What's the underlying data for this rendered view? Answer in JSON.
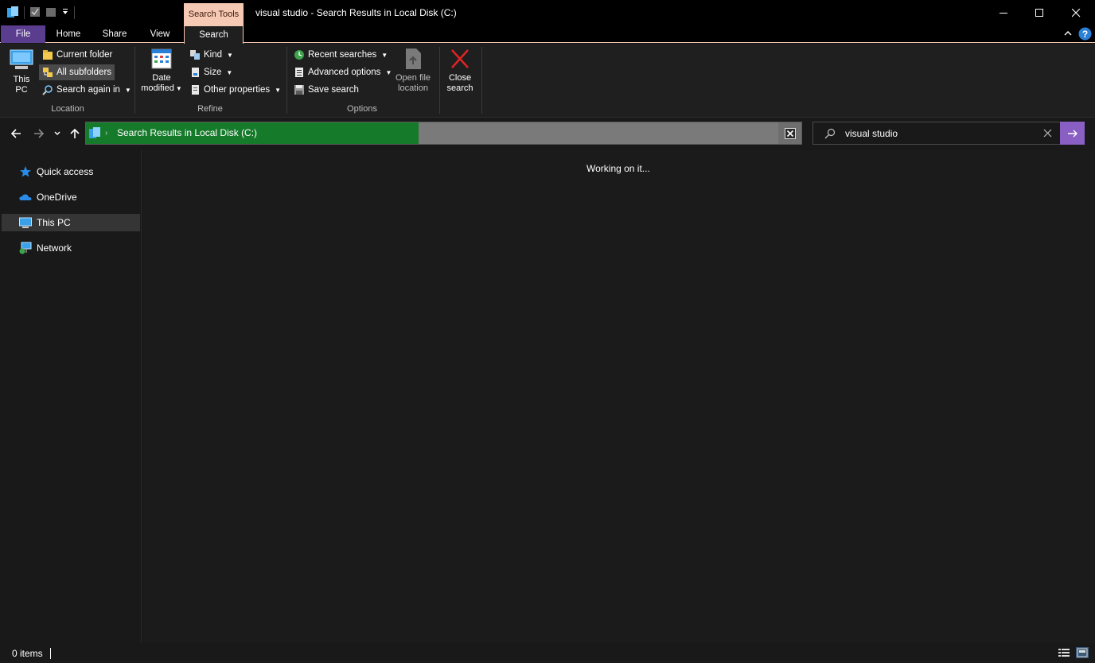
{
  "window": {
    "title": "visual studio - Search Results in Local Disk (C:)",
    "contextual_tab_group": "Search Tools",
    "accent_color": "#f6c9b4",
    "file_tab_color": "#5a3d8f"
  },
  "tabs": [
    {
      "label": "File"
    },
    {
      "label": "Home"
    },
    {
      "label": "Share"
    },
    {
      "label": "View"
    },
    {
      "label": "Search"
    }
  ],
  "ribbon": {
    "location": {
      "label": "Location",
      "this_pc": {
        "line1": "This",
        "line2": "PC"
      },
      "current_folder": "Current folder",
      "all_subfolders": "All subfolders",
      "search_again_in": "Search again in"
    },
    "refine": {
      "label": "Refine",
      "date_modified": {
        "line1": "Date",
        "line2": "modified"
      },
      "kind": "Kind",
      "size": "Size",
      "other_properties": "Other properties"
    },
    "options": {
      "label": "Options",
      "recent_searches": "Recent searches",
      "advanced_options": "Advanced options",
      "save_search": "Save search",
      "open_file_location": {
        "line1": "Open file",
        "line2": "location"
      },
      "close_search": {
        "line1": "Close",
        "line2": "search"
      }
    }
  },
  "address": {
    "path": "Search Results in Local Disk (C:)",
    "progress_fraction": 0.48,
    "progress_color": "#157a2a"
  },
  "search": {
    "value": "visual studio",
    "go_color": "#8a5fc4"
  },
  "nav": {
    "items": [
      {
        "label": "Quick access",
        "icon": "star-icon"
      },
      {
        "label": "OneDrive",
        "icon": "cloud-icon"
      },
      {
        "label": "This PC",
        "icon": "computer-icon",
        "selected": true
      },
      {
        "label": "Network",
        "icon": "network-icon"
      }
    ]
  },
  "content": {
    "message": "Working on it..."
  },
  "status": {
    "items_count": "0 items"
  }
}
